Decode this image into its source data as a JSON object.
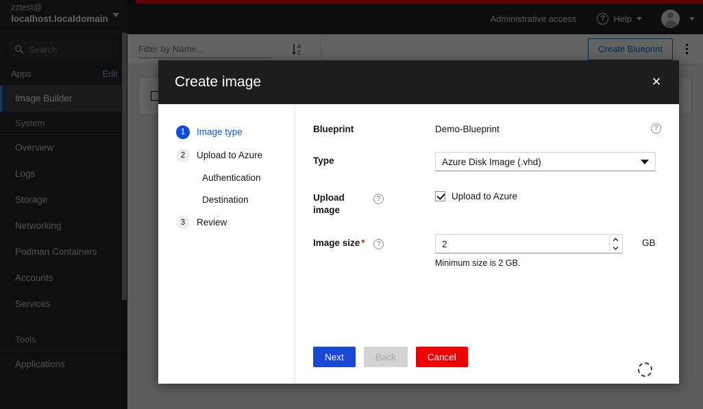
{
  "sidebar": {
    "account_user": "zztest@",
    "account_host": "localhost.localdomain",
    "search_placeholder": "Search",
    "apps_label": "Apps",
    "edit_label": "Edit",
    "apps_items": [
      {
        "label": "Image Builder",
        "active": true
      }
    ],
    "groups": [
      {
        "title": "System",
        "items": [
          {
            "label": "Overview"
          },
          {
            "label": "Logs"
          },
          {
            "label": "Storage"
          },
          {
            "label": "Networking"
          },
          {
            "label": "Podman Containers"
          },
          {
            "label": "Accounts"
          },
          {
            "label": "Services"
          }
        ]
      },
      {
        "title": "Tools",
        "items": [
          {
            "label": "Applications"
          }
        ]
      }
    ]
  },
  "topbar": {
    "admin_access": "Administrative access",
    "help_label": "Help",
    "help_icon": "question-circle-icon",
    "user_icon": "user-avatar-icon",
    "accent_red": "#ee0000"
  },
  "page": {
    "filter_placeholder": "Filter by Name...",
    "filter_value": "",
    "sort_icon": "sort-alpha-asc-icon",
    "create_blueprint_label": "Create Blueprint",
    "kebab_icon": "kebab-vertical-icon"
  },
  "modal": {
    "title": "Create image",
    "close_icon": "close-icon",
    "wizard_steps": [
      {
        "num": "1",
        "label": "Image type",
        "active": true,
        "sub": false
      },
      {
        "num": "2",
        "label": "Upload to Azure",
        "active": false,
        "sub": false
      },
      {
        "num": "",
        "label": "Authentication",
        "active": false,
        "sub": true
      },
      {
        "num": "",
        "label": "Destination",
        "active": false,
        "sub": true
      },
      {
        "num": "3",
        "label": "Review",
        "active": false,
        "sub": false
      }
    ],
    "fields": {
      "blueprint_label": "Blueprint",
      "blueprint_value": "Demo-Blueprint",
      "blueprint_help_icon": "help-circle-icon",
      "type_label": "Type",
      "type_value": "Azure Disk Image (.vhd)",
      "type_options": [
        "Azure Disk Image (.vhd)"
      ],
      "upload_label": "Upload image",
      "upload_help_icon": "help-circle-icon",
      "upload_checkbox_label": "Upload to Azure",
      "upload_checked": true,
      "size_label": "Image size",
      "size_required": "*",
      "size_help_icon": "help-circle-icon",
      "size_value": "2",
      "size_unit": "GB",
      "size_helper": "Minimum size is 2 GB.",
      "spin_up_icon": "chevron-up-icon",
      "spin_down_icon": "chevron-down-icon"
    },
    "footer": {
      "next_label": "Next",
      "back_label": "Back",
      "back_disabled": true,
      "cancel_label": "Cancel",
      "spinner_icon": "loading-spinner-icon"
    }
  }
}
